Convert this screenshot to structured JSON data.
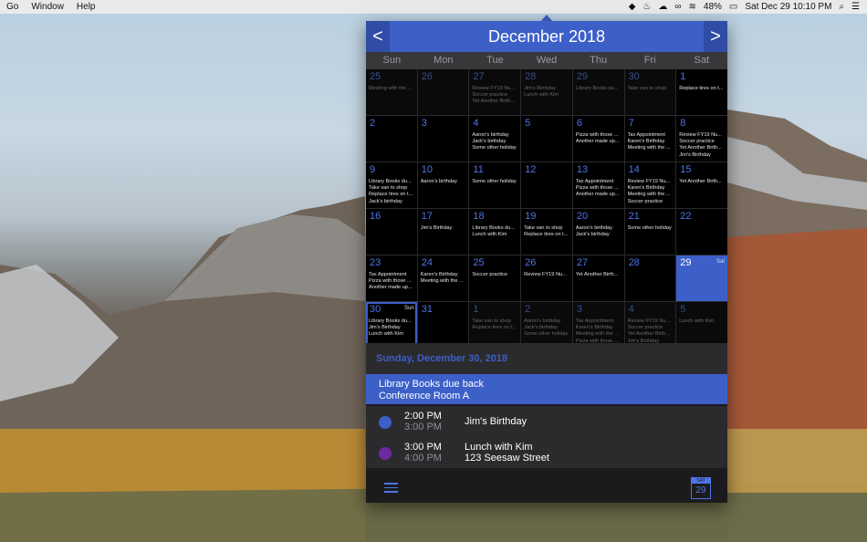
{
  "menubar": {
    "items": [
      "Go",
      "Window",
      "Help"
    ],
    "battery": "48%",
    "clock": "Sat Dec 29  10:10 PM"
  },
  "calendar": {
    "title": "December 2018",
    "prev_label": "<",
    "next_label": ">",
    "weekdays": [
      "Sun",
      "Mon",
      "Tue",
      "Wed",
      "Thu",
      "Fri",
      "Sat"
    ],
    "cells": [
      {
        "n": "25",
        "other": true,
        "ev": [
          "Meeting with the ..."
        ]
      },
      {
        "n": "26",
        "other": true,
        "ev": []
      },
      {
        "n": "27",
        "other": true,
        "ev": [
          "Review FY19 Nu...",
          "Soccer practice",
          "Yet Another Birth..."
        ]
      },
      {
        "n": "28",
        "other": true,
        "ev": [
          "Jim's Birthday",
          "Lunch with Kim"
        ]
      },
      {
        "n": "29",
        "other": true,
        "ev": [
          "Library Books du..."
        ]
      },
      {
        "n": "30",
        "other": true,
        "ev": [
          "Take van to shop"
        ]
      },
      {
        "n": "1",
        "ev": [
          "Replace tires on t..."
        ]
      },
      {
        "n": "2",
        "ev": []
      },
      {
        "n": "3",
        "ev": []
      },
      {
        "n": "4",
        "ev": [
          "Aaron's birthday",
          "Jack's birthday",
          "Some other holiday"
        ]
      },
      {
        "n": "5",
        "ev": []
      },
      {
        "n": "6",
        "ev": [
          "Pizza with those ...",
          "Another made up..."
        ]
      },
      {
        "n": "7",
        "ev": [
          "Tax Appointment",
          "Karen's Birthday",
          "Meeting with the ..."
        ]
      },
      {
        "n": "8",
        "ev": [
          "Review FY19 Nu...",
          "Soccer practice",
          "Yet Another Birth...",
          "Jim's Birthday"
        ]
      },
      {
        "n": "9",
        "ev": [
          "Library Books du...",
          "Take van to shop",
          "Replace tires on t...",
          "Jack's birthday"
        ]
      },
      {
        "n": "10",
        "ev": [
          "Aaron's birthday"
        ]
      },
      {
        "n": "11",
        "ev": [
          "Some other holiday"
        ]
      },
      {
        "n": "12",
        "ev": []
      },
      {
        "n": "13",
        "ev": [
          "Tax Appointment",
          "Pizza with those ...",
          "Another made up..."
        ]
      },
      {
        "n": "14",
        "ev": [
          "Review FY19 Nu...",
          "Karen's Birthday",
          "Meeting with the ...",
          "Soccer practice"
        ]
      },
      {
        "n": "15",
        "ev": [
          "Yet Another Birth..."
        ]
      },
      {
        "n": "16",
        "ev": []
      },
      {
        "n": "17",
        "ev": [
          "Jim's Birthday"
        ]
      },
      {
        "n": "18",
        "ev": [
          "Library Books du...",
          "Lunch with Kim"
        ]
      },
      {
        "n": "19",
        "ev": [
          "Take van to shop",
          "Replace tires on t..."
        ]
      },
      {
        "n": "20",
        "ev": [
          "Aaron's birthday",
          "Jack's birthday"
        ]
      },
      {
        "n": "21",
        "ev": [
          "Some other holiday"
        ]
      },
      {
        "n": "22",
        "ev": []
      },
      {
        "n": "23",
        "ev": [
          "Tax Appointment",
          "Pizza with those ...",
          "Another made up..."
        ]
      },
      {
        "n": "24",
        "ev": [
          "Karen's Birthday",
          "Meeting with the ..."
        ]
      },
      {
        "n": "25",
        "ev": [
          "Soccer practice"
        ]
      },
      {
        "n": "26",
        "ev": [
          "Review FY19 Nu..."
        ]
      },
      {
        "n": "27",
        "ev": [
          "Yet Another Birth..."
        ]
      },
      {
        "n": "28",
        "ev": []
      },
      {
        "n": "29",
        "today": true,
        "wk": "Sat",
        "ev": []
      },
      {
        "n": "30",
        "sel": true,
        "wk": "Sun",
        "ev": [
          "Library Books du...",
          "Jim's Birthday",
          "Lunch with Kim"
        ]
      },
      {
        "n": "31",
        "ev": []
      },
      {
        "n": "1",
        "other": true,
        "ev": [
          "Take van to shop",
          "Replace tires on t..."
        ]
      },
      {
        "n": "2",
        "other": true,
        "ev": [
          "Aaron's birthday",
          "Jack's birthday",
          "Some other holiday"
        ]
      },
      {
        "n": "3",
        "other": true,
        "ev": [
          "Tax Appointment",
          "Karen's Birthday",
          "Meeting with the ...",
          "Pizza with those ..."
        ]
      },
      {
        "n": "4",
        "other": true,
        "ev": [
          "Review FY19 Nu...",
          "Soccer practice",
          "Yet Another Birth...",
          "Jim's Birthday"
        ]
      },
      {
        "n": "5",
        "other": true,
        "ev": [
          "Lunch with Kim"
        ]
      }
    ]
  },
  "day": {
    "heading": "Sunday, December 30, 2018",
    "allday_title": "Library Books due back",
    "allday_location": "Conference Room A",
    "events": [
      {
        "start": "2:00 PM",
        "end": "3:00 PM",
        "title": "Jim's Birthday",
        "location": "",
        "color": "#3c5fc8"
      },
      {
        "start": "3:00 PM",
        "end": "4:00 PM",
        "title": "Lunch with Kim",
        "location": "123 Seesaw Street",
        "color": "#6b2aa0"
      }
    ]
  },
  "footer": {
    "mini_month": "SAT",
    "mini_day": "29"
  },
  "colors": {
    "accent": "#3c5fc8",
    "background": "#1b1b1d"
  }
}
